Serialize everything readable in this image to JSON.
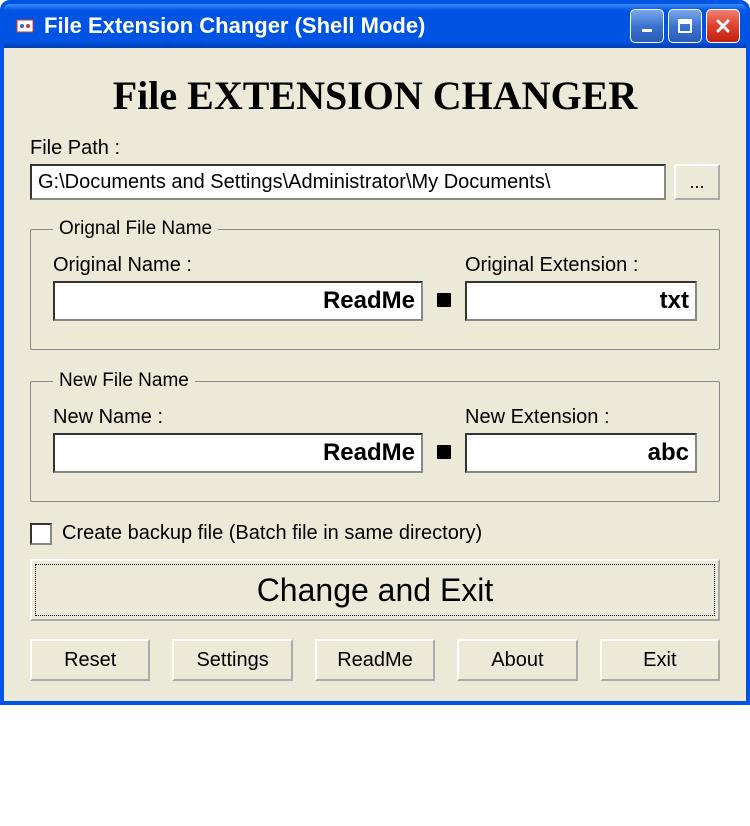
{
  "window": {
    "title": "File Extension Changer (Shell Mode)"
  },
  "app_title": "File EXTENSION CHANGER",
  "file_path": {
    "label": "File Path :",
    "value": "G:\\Documents and Settings\\Administrator\\My Documents\\",
    "browse_label": "..."
  },
  "original": {
    "legend": "Orignal File Name",
    "name_label": "Original Name :",
    "name_value": "ReadMe",
    "ext_label": "Original Extension :",
    "ext_value": "txt"
  },
  "new": {
    "legend": "New File Name",
    "name_label": "New Name :",
    "name_value": "ReadMe",
    "ext_label": "New Extension :",
    "ext_value": "abc"
  },
  "backup": {
    "label": "Create backup file (Batch file in same directory)",
    "checked": false
  },
  "main_button": "Change and Exit",
  "buttons": {
    "reset": "Reset",
    "settings": "Settings",
    "readme": "ReadMe",
    "about": "About",
    "exit": "Exit"
  }
}
